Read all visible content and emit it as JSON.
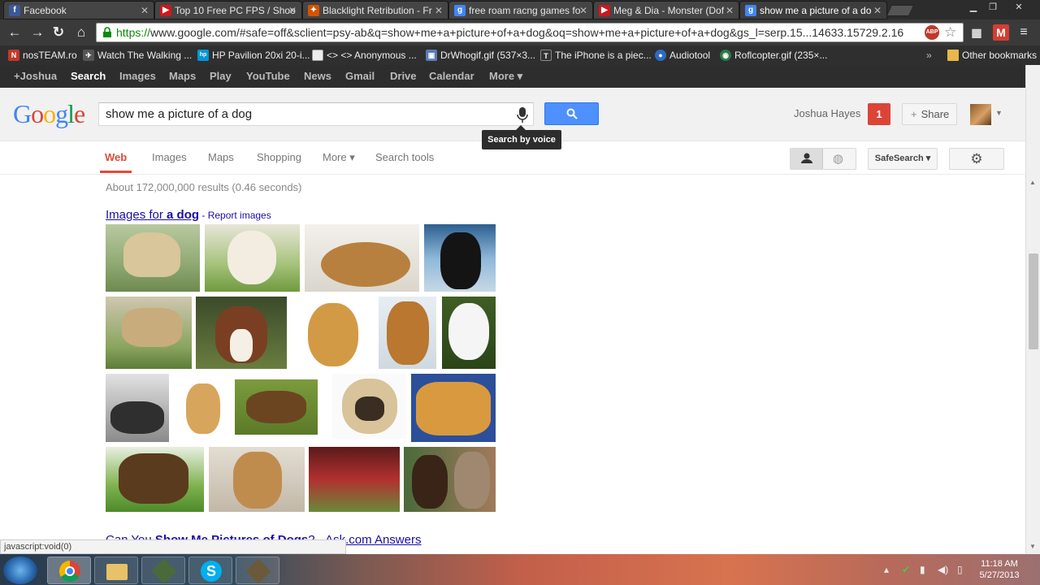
{
  "browser": {
    "tabs": [
      {
        "title": "Facebook",
        "favicon": "facebook-icon",
        "color": "#3b5998",
        "glyph": "f"
      },
      {
        "title": "Top 10 Free PC FPS / Shoo",
        "favicon": "youtube-icon",
        "color": "#cc181e",
        "glyph": "▶"
      },
      {
        "title": "Blacklight Retribution - Fr",
        "favicon": "blacklight-icon",
        "color": "#d35400",
        "glyph": "✦"
      },
      {
        "title": "free roam racng games fo",
        "favicon": "google-icon",
        "color": "#4285f4",
        "glyph": "g"
      },
      {
        "title": "Meg & Dia - Monster (Dof",
        "favicon": "youtube-icon",
        "color": "#cc181e",
        "glyph": "▶"
      },
      {
        "title": "show me a picture of a do",
        "favicon": "google-icon",
        "color": "#4285f4",
        "glyph": "g"
      }
    ],
    "url_scheme": "https://",
    "url_rest": "www.google.com/#safe=off&sclient=psy-ab&q=show+me+a+picture+of+a+dog&oq=show+me+a+picture+of+a+dog&gs_l=serp.15...14633.15729.2.16",
    "abp_label": "ABP",
    "bookmarks": [
      {
        "label": "nosTEAM.ro",
        "icon": "nosteam-icon",
        "color": "#c0392b",
        "glyph": "N"
      },
      {
        "label": "Watch The Walking ...",
        "icon": "walking-icon",
        "color": "#555",
        "glyph": "✈"
      },
      {
        "label": "HP Pavilion 20xi 20-i...",
        "icon": "hp-icon",
        "color": "#0096d6",
        "glyph": "hp"
      },
      {
        "label": "<> <> Anonymous ...",
        "icon": "page-icon",
        "color": "#ddd",
        "glyph": " "
      },
      {
        "label": "DrWhogif.gif (537×3...",
        "icon": "image-icon",
        "color": "#5a7bb5",
        "glyph": "▣"
      },
      {
        "label": "The iPhone is a piec...",
        "icon": "site-icon",
        "color": "#333",
        "glyph": "T"
      },
      {
        "label": "Audiotool",
        "icon": "audiotool-icon",
        "color": "#2b6cc4",
        "glyph": "●"
      },
      {
        "label": "Roflcopter.gif (235×...",
        "icon": "globe-icon",
        "color": "#2a7a4a",
        "glyph": "◉"
      }
    ],
    "bookmarks_more": "»",
    "other_bookmarks": "Other bookmarks"
  },
  "gbar": {
    "items": [
      "+Joshua",
      "Search",
      "Images",
      "Maps",
      "Play",
      "YouTube",
      "News",
      "Gmail",
      "Drive",
      "Calendar",
      "More ▾"
    ]
  },
  "header": {
    "logo": "Google",
    "query": "show me a picture of a dog",
    "tooltip": "Search by voice",
    "username": "Joshua Hayes",
    "notifications": "1",
    "share": "Share"
  },
  "search_nav": {
    "tabs": [
      "Web",
      "Images",
      "Maps",
      "Shopping",
      "More ▾",
      "Search tools"
    ],
    "safesearch": "SafeSearch ▾"
  },
  "results": {
    "stats": "About 172,000,000 results (0.46 seconds)",
    "images_for": "Images for ",
    "images_for_bold": "a dog",
    "report": " - Report images",
    "second_result_prefix": "Can You ",
    "second_result_bold": "Show Me Pictures of Dogs",
    "second_result_suffix": "? - Ask.com Answers",
    "status_url": "javascript:void(0)"
  },
  "taskbar": {
    "time": "11:18 AM",
    "date": "5/27/2013"
  }
}
